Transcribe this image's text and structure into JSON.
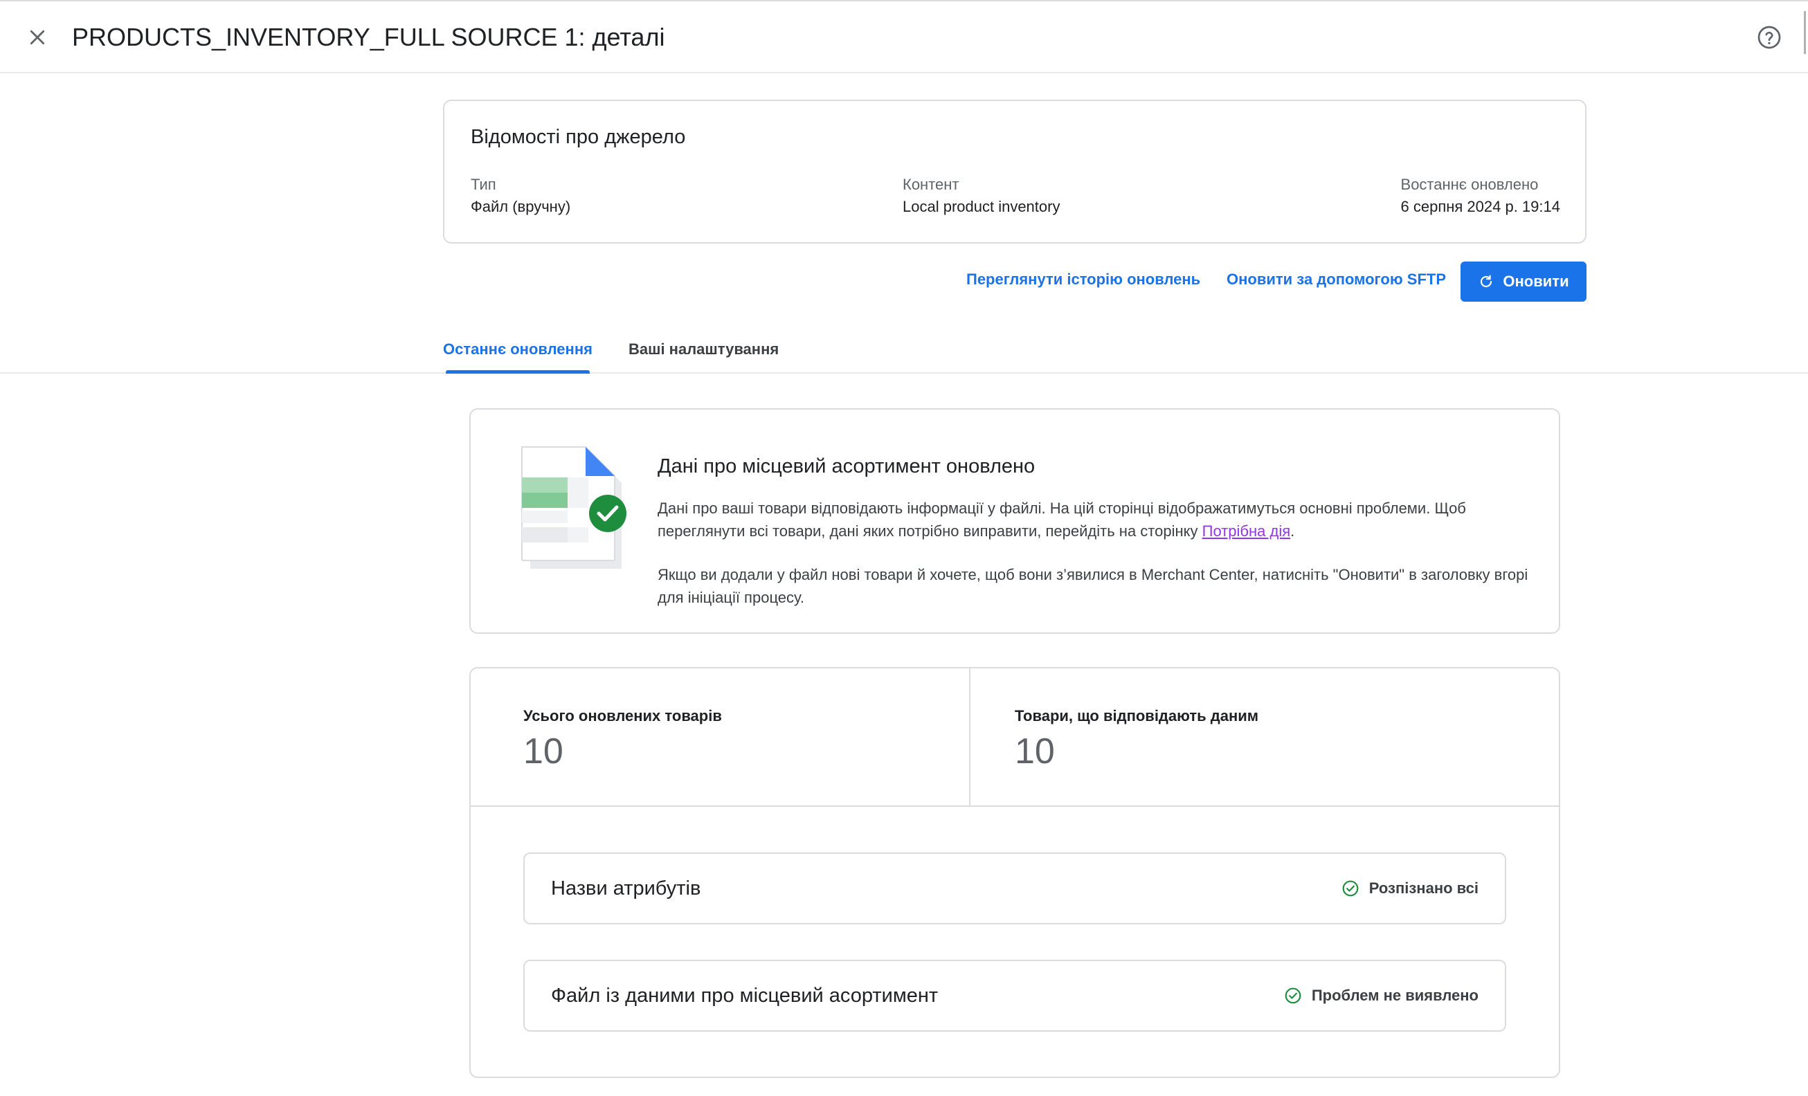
{
  "header": {
    "title": "PRODUCTS_INVENTORY_FULL SOURCE 1: деталі",
    "close_icon": "close-icon",
    "help_icon": "help-icon"
  },
  "source_info": {
    "heading": "Відомості про джерело",
    "type_label": "Тип",
    "type_value": "Файл (вручну)",
    "content_label": "Контент",
    "content_value": "Local product inventory",
    "updated_label": "Востаннє оновлено",
    "updated_value": "6 серпня 2024 р. 19:14"
  },
  "actions": {
    "history_label": "Переглянути історію оновлень",
    "sftp_label": "Оновити за допомогою SFTP",
    "refresh_label": "Оновити",
    "refresh_icon": "refresh-icon"
  },
  "tabs": [
    {
      "label": "Останнє оновлення",
      "active": true
    },
    {
      "label": "Ваші налаштування",
      "active": false
    }
  ],
  "status": {
    "title": "Дані про місцевий асортимент оновлено",
    "paragraph1_before": "Дані про ваші товари відповідають інформації у файлі. На цій сторінці відображатимуться основні проблеми. Щоб переглянути всі товари, дані яких потрібно виправити, перейдіть на сторінку ",
    "paragraph1_link": "Потрібна дія",
    "paragraph1_after": ".",
    "paragraph2": "Якщо ви додали у файл нові товари й хочете, щоб вони з’явилися в Merchant Center, натисніть \"Оновити\" в заголовку вгорі для ініціації процесу.",
    "illustration_icon": "spreadsheet-file-check-icon"
  },
  "stats": {
    "total_label": "Усього оновлених товарів",
    "total_value": "10",
    "matching_label": "Товари, що відповідають даним",
    "matching_value": "10"
  },
  "checks": [
    {
      "label": "Назви атрибутів",
      "status": "Розпізнано всі"
    },
    {
      "label": "Файл із даними про місцевий асортимент",
      "status": "Проблем не виявлено"
    }
  ],
  "colors": {
    "accent": "#1a73e8",
    "success": "#1e8e3e",
    "link_visited": "#9334e6",
    "border": "#dadce0"
  }
}
